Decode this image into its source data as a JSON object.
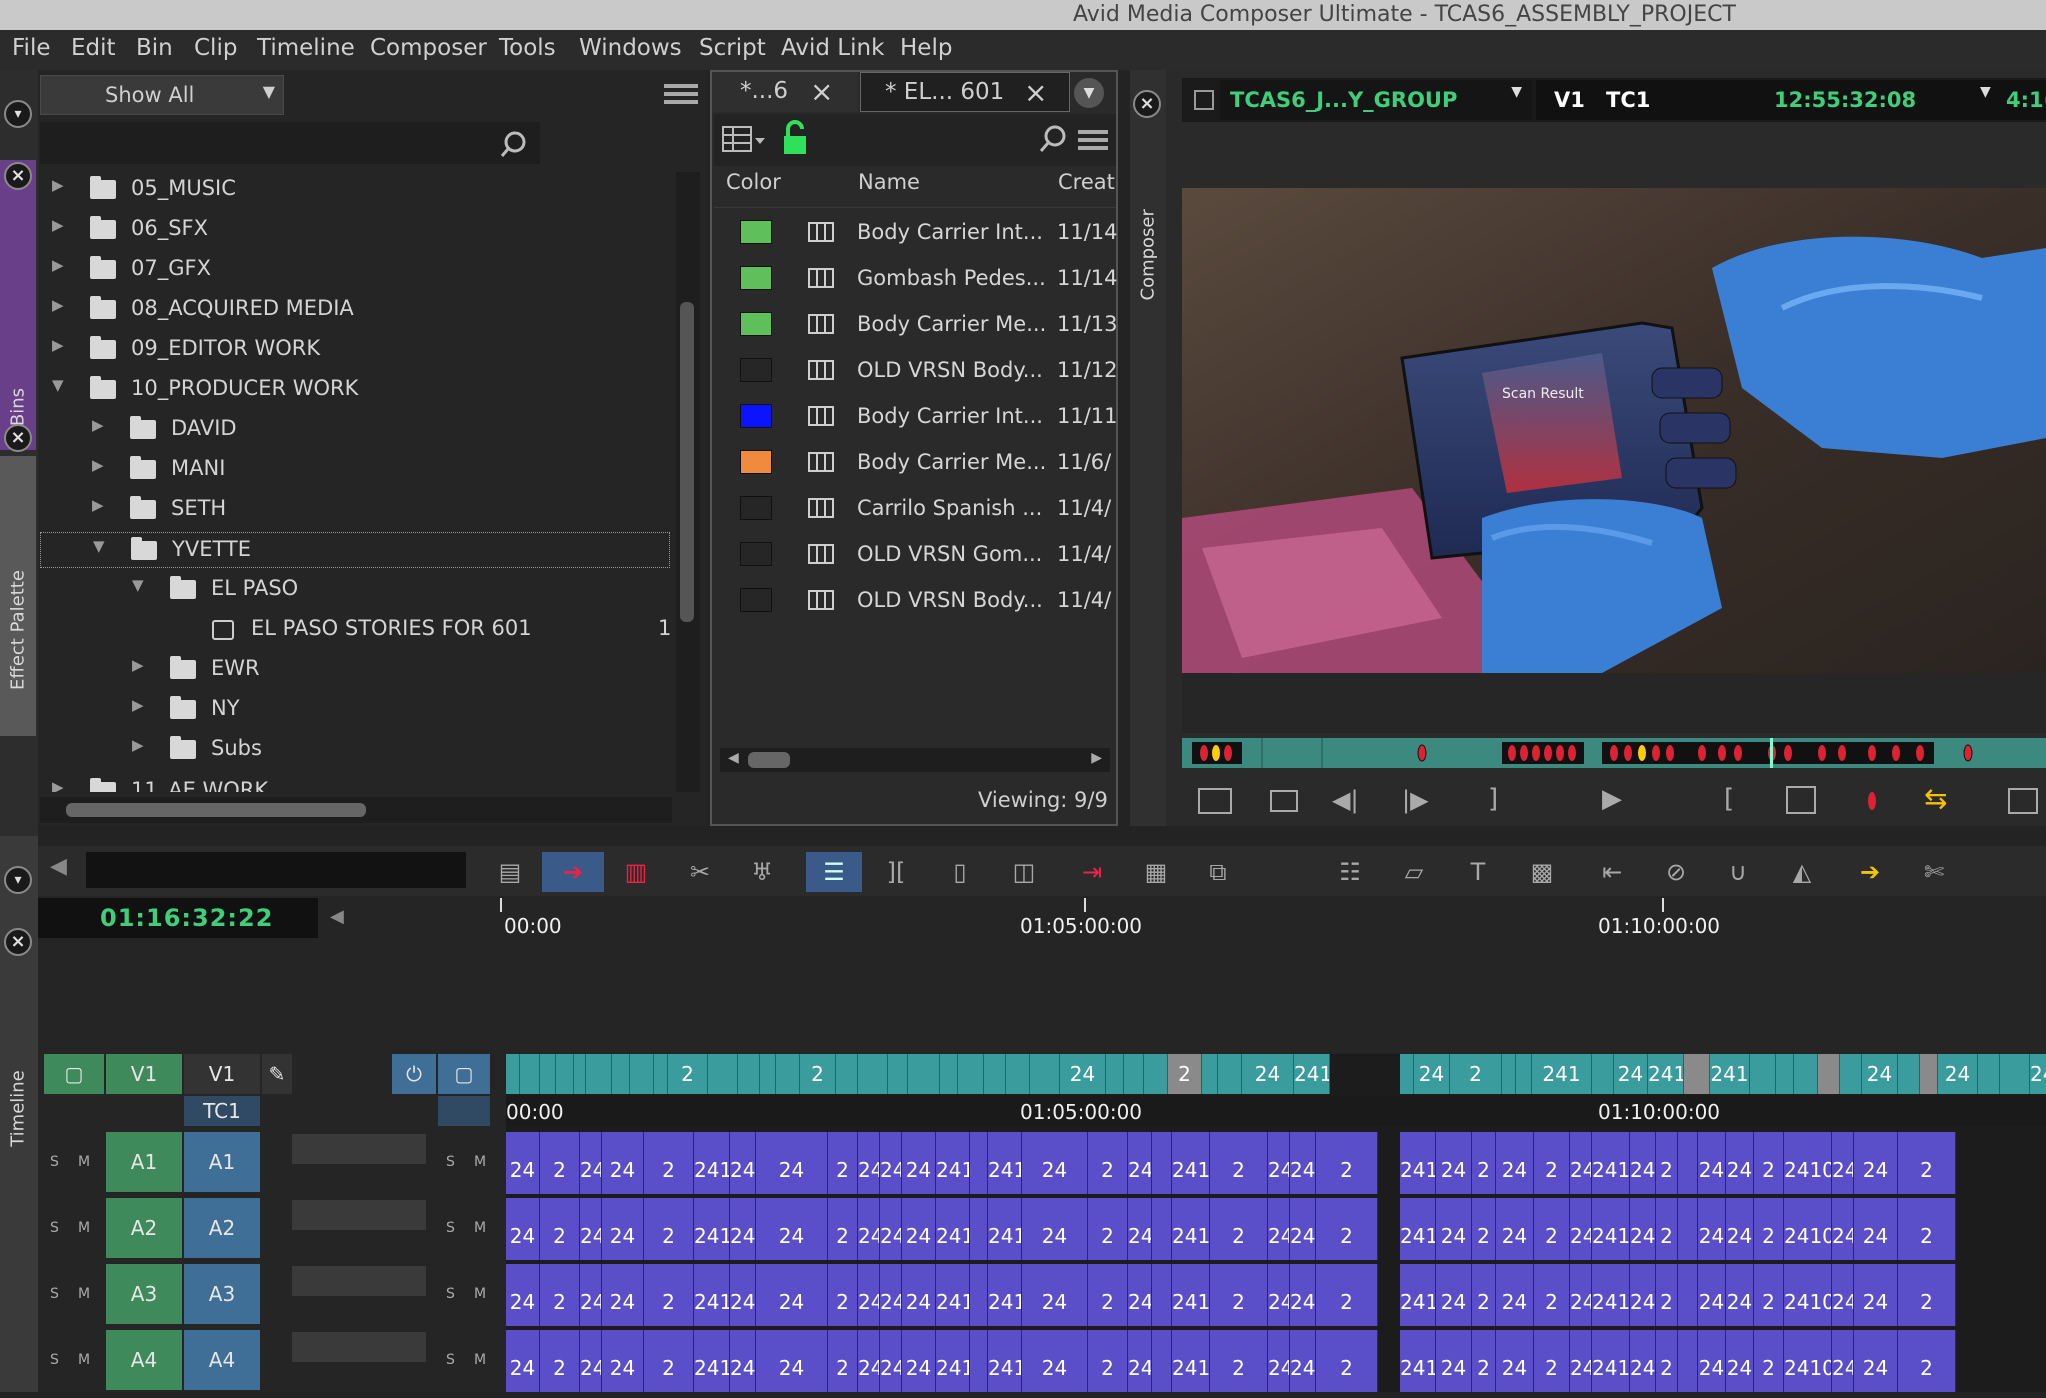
{
  "window": {
    "title": "Avid Media Composer Ultimate  - TCAS6_ASSEMBLY_PROJECT"
  },
  "menu": [
    "File",
    "Edit",
    "Bin",
    "Clip",
    "Timeline",
    "Composer",
    "Tools",
    "Windows",
    "Script",
    "Avid Link",
    "Help"
  ],
  "side_tabs": {
    "bins": "Bins",
    "effect_palette": "Effect Palette",
    "composer": "Composer",
    "timeline": "Timeline"
  },
  "bins_panel": {
    "filter": "Show All",
    "tree": [
      {
        "label": "05_MUSIC",
        "level": 0,
        "state": "closed"
      },
      {
        "label": "06_SFX",
        "level": 0,
        "state": "closed"
      },
      {
        "label": "07_GFX",
        "level": 0,
        "state": "closed"
      },
      {
        "label": "08_ACQUIRED MEDIA",
        "level": 0,
        "state": "closed"
      },
      {
        "label": "09_EDITOR WORK",
        "level": 0,
        "state": "closed"
      },
      {
        "label": "10_PRODUCER WORK",
        "level": 0,
        "state": "open"
      },
      {
        "label": "DAVID",
        "level": 1,
        "state": "closed"
      },
      {
        "label": "MANI",
        "level": 1,
        "state": "closed"
      },
      {
        "label": "SETH",
        "level": 1,
        "state": "closed"
      },
      {
        "label": "YVETTE",
        "level": 1,
        "state": "open"
      },
      {
        "label": "EL PASO",
        "level": 2,
        "state": "open"
      },
      {
        "label": "EL PASO STORIES FOR 601",
        "level": 3,
        "state": "bin"
      },
      {
        "label": "EWR",
        "level": 2,
        "state": "closed"
      },
      {
        "label": "NY",
        "level": 2,
        "state": "closed"
      },
      {
        "label": "Subs",
        "level": 2,
        "state": "closed"
      },
      {
        "label": "11_AE WORK",
        "level": 0,
        "state": "closed"
      }
    ],
    "bin_count_fragment": "1("
  },
  "bin_window": {
    "tabs": [
      "*...6",
      "* EL... 601"
    ],
    "columns": [
      "Color",
      "Name",
      "Creat"
    ],
    "rows": [
      {
        "color": "#5fbf5a",
        "name": "Body Carrier Int...",
        "created": "11/14"
      },
      {
        "color": "#5fbf5a",
        "name": "Gombash Pedes...",
        "created": "11/14"
      },
      {
        "color": "#5fbf5a",
        "name": "Body Carrier Me...",
        "created": "11/13"
      },
      {
        "color": "",
        "name": "OLD VRSN Body...",
        "created": "11/12"
      },
      {
        "color": "#0a14ff",
        "name": "Body Carrier Int...",
        "created": "11/11"
      },
      {
        "color": "#f08a3c",
        "name": "Body Carrier Me...",
        "created": "11/6/"
      },
      {
        "color": "",
        "name": "Carrilo Spanish ...",
        "created": "11/4/"
      },
      {
        "color": "",
        "name": "OLD VRSN Gom...",
        "created": "11/4/"
      },
      {
        "color": "",
        "name": "OLD VRSN Body...",
        "created": "11/4/"
      }
    ],
    "viewing": "Viewing: 9/9"
  },
  "viewer": {
    "sequence": "TCAS6_J...Y_GROUP",
    "track": "V1",
    "tc_label": "TC1",
    "timecode": "12:55:32:08",
    "extra": "4:1("
  },
  "timeline": {
    "timecode": "01:16:32:22",
    "ruler": [
      "00:00",
      "01:05:00:00",
      "01:10:00:00"
    ],
    "tracks": {
      "video": {
        "source": "V1",
        "record": "V1"
      },
      "tc": "TC1",
      "audio": [
        {
          "source": "A1",
          "record": "A1"
        },
        {
          "source": "A2",
          "record": "A2"
        },
        {
          "source": "A3",
          "record": "A3"
        },
        {
          "source": "A4",
          "record": "A4"
        }
      ]
    },
    "video_clip_labels": [
      "2",
      "2",
      "24",
      "2",
      "24",
      "24102",
      "24",
      "2",
      "241",
      "24",
      "241028",
      "241",
      "24",
      "24",
      "2410:",
      "2",
      "241",
      "24",
      "241",
      "2",
      "2",
      "24",
      "241",
      "24102"
    ],
    "audio_clip_labels": [
      "24",
      "2",
      "24",
      "24",
      "2",
      "24102",
      "24",
      "24",
      "2",
      "24",
      "241",
      "24",
      "241028",
      "241",
      "24",
      "2",
      "24",
      "2410:",
      "2",
      "241",
      "241",
      "2",
      "241",
      "24",
      "2",
      "24",
      "2",
      "241",
      "24102"
    ],
    "colors": {
      "video": "#3a9c9c",
      "audio": "#5a4fc8",
      "timecode_green": "#3fcf7a"
    }
  }
}
